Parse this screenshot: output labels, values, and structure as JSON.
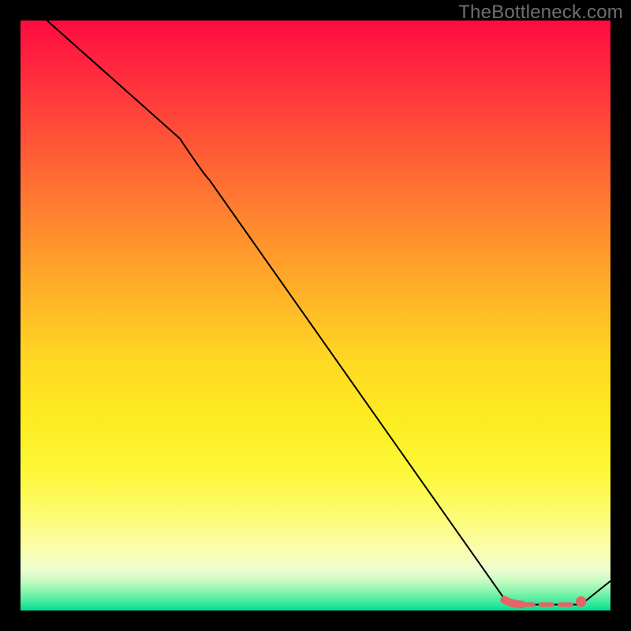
{
  "watermark": "TheBottleneck.com",
  "colors": {
    "gradient_top": "#ff0b40",
    "gradient_mid": "#ffd923",
    "gradient_bottom": "#00dd90",
    "curve": "#000000",
    "marker": "#e46565",
    "frame_bg": "#000000"
  },
  "chart_data": {
    "type": "line",
    "title": "",
    "xlabel": "",
    "ylabel": "",
    "x_range": [
      0,
      100
    ],
    "y_range": [
      0,
      100
    ],
    "note": "axes unlabeled; values are percent of plot area (0 = left/bottom, 100 = right/top)",
    "series": [
      {
        "name": "bottleneck-curve",
        "points": [
          {
            "x": 0,
            "y": 104
          },
          {
            "x": 27,
            "y": 80
          },
          {
            "x": 32,
            "y": 73
          },
          {
            "x": 82,
            "y": 2
          },
          {
            "x": 85,
            "y": 1
          },
          {
            "x": 95,
            "y": 1
          },
          {
            "x": 100,
            "y": 5
          }
        ]
      }
    ],
    "highlight_segment": {
      "name": "optimal-range",
      "start_x": 82,
      "end_x": 95,
      "y": 1
    },
    "highlight_point": {
      "x": 95,
      "y": 1.5
    }
  }
}
